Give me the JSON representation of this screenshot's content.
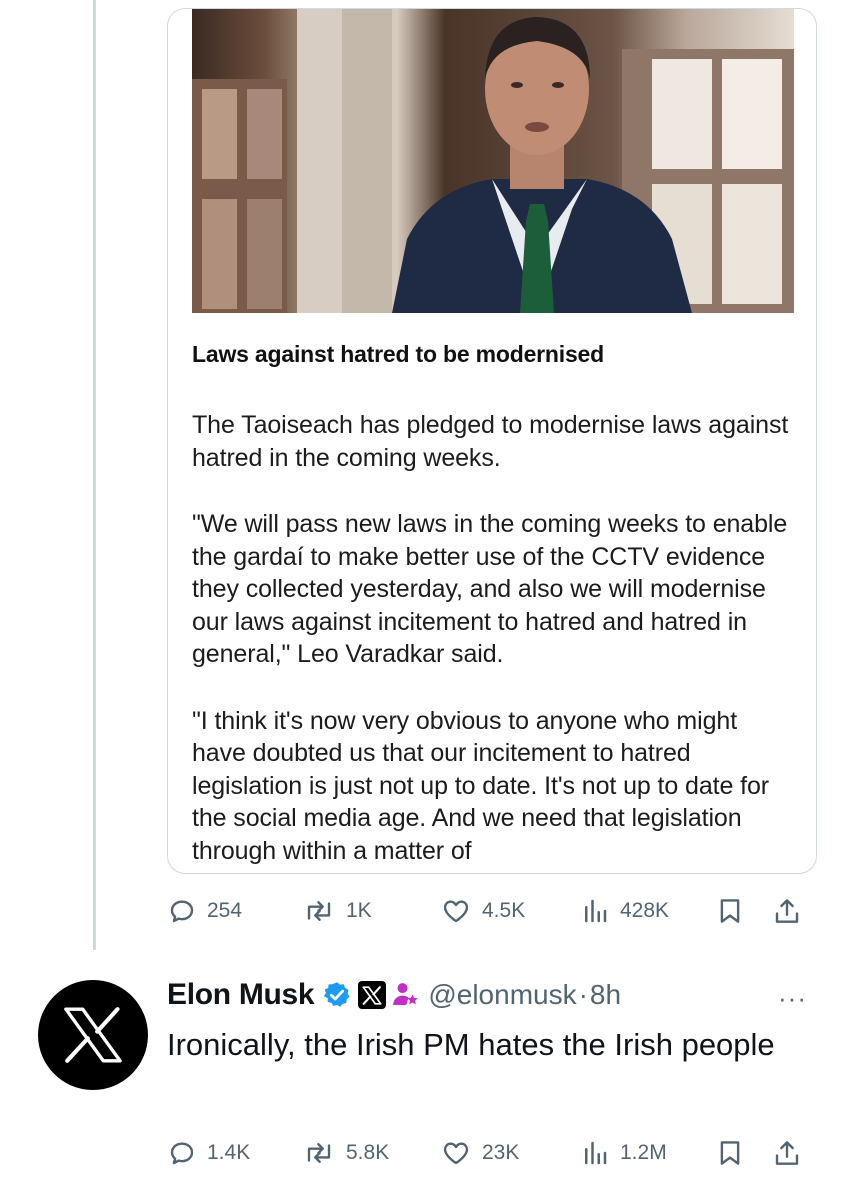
{
  "article": {
    "headline": "Laws against hatred to be modernised",
    "paragraphs": [
      "The Taoiseach has pledged to modernise laws against hatred in the coming weeks.",
      "\"We will pass new laws in the coming weeks to enable the gardaí to make better use of the CCTV evidence they collected yesterday, and also we will modernise our laws against incitement to hatred and hatred in general,\" Leo Varadkar said.",
      "\"I think it's now very obvious to anyone who might have doubted us that our incitement to hatred legislation is just not up to date. It's not up to date for the social media age. And we need that legislation through within a matter of"
    ]
  },
  "quoted_tweet_actions": {
    "replies": "254",
    "reposts": "1K",
    "likes": "4.5K",
    "views": "428K"
  },
  "reply": {
    "name": "Elon Musk",
    "handle": "@elonmusk",
    "separator": "·",
    "time": "8h",
    "more": "···",
    "text": "Ironically, the Irish PM hates the Irish people",
    "actions": {
      "replies": "1.4K",
      "reposts": "5.8K",
      "likes": "23K",
      "views": "1.2M"
    }
  },
  "icons": {
    "reply": "reply-icon",
    "repost": "repost-icon",
    "like": "heart-icon",
    "views": "views-chart-icon",
    "bookmark": "bookmark-icon",
    "share": "share-icon",
    "verified": "verified-badge-icon",
    "x_logo": "x-logo-icon",
    "affiliate": "affiliate-person-icon"
  },
  "colors": {
    "text": "#0f1419",
    "secondary": "#536471",
    "verified_blue": "#1d9bf0",
    "affiliate_pink": "#c12fc9",
    "border": "#cfd9de"
  }
}
